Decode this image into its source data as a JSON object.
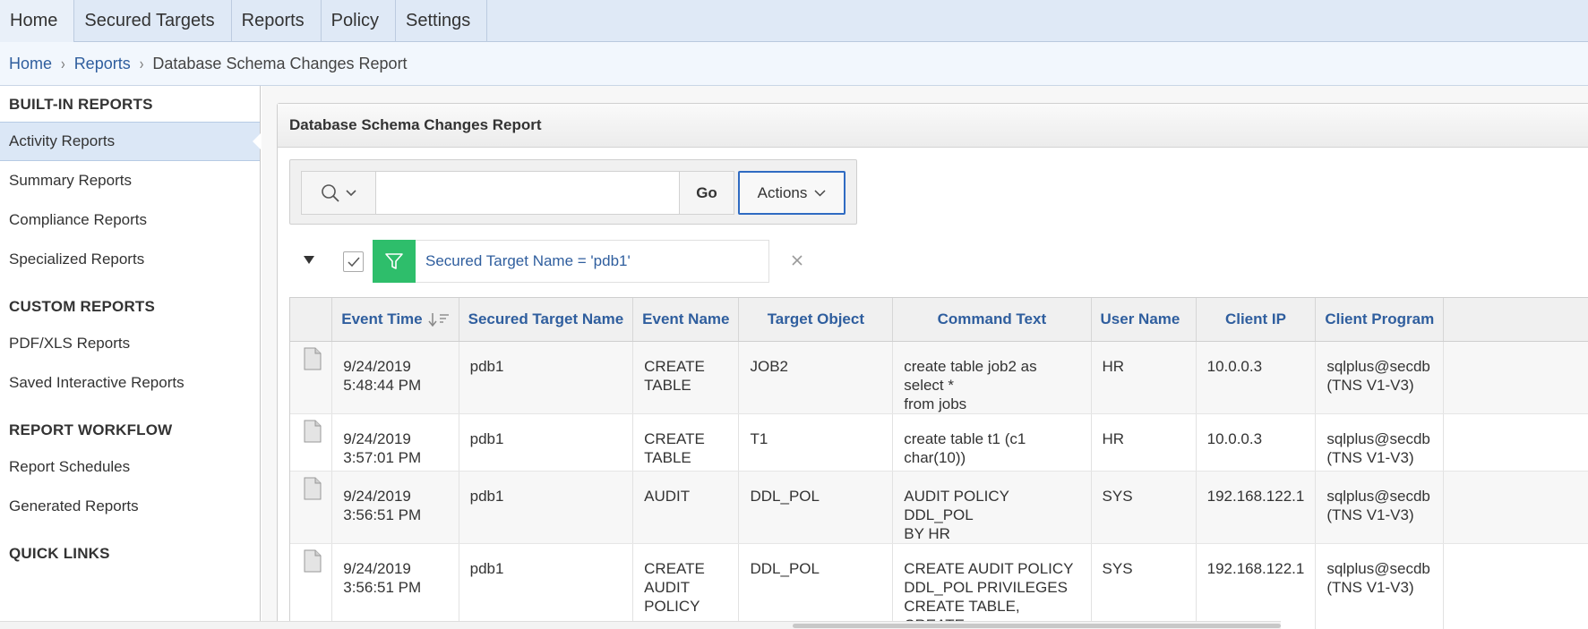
{
  "topnav": {
    "tabs": [
      "Home",
      "Secured Targets",
      "Reports",
      "Policy",
      "Settings"
    ]
  },
  "breadcrumb": {
    "home": "Home",
    "reports": "Reports",
    "current": "Database Schema Changes Report"
  },
  "sidebar": {
    "builtin_heading": "BUILT-IN REPORTS",
    "builtin_items": [
      "Activity Reports",
      "Summary Reports",
      "Compliance Reports",
      "Specialized Reports"
    ],
    "custom_heading": "CUSTOM REPORTS",
    "custom_items": [
      "PDF/XLS Reports",
      "Saved Interactive Reports"
    ],
    "workflow_heading": "REPORT WORKFLOW",
    "workflow_items": [
      "Report Schedules",
      "Generated Reports"
    ],
    "quicklinks_heading": "QUICK LINKS",
    "active_item": "Activity Reports"
  },
  "report": {
    "title": "Database Schema Changes Report",
    "search": {
      "value": "",
      "placeholder": ""
    },
    "go_label": "Go",
    "actions_label": "Actions",
    "filter_text": "Secured Target Name = 'pdb1'",
    "columns": [
      "Event Time",
      "Secured Target Name",
      "Event Name",
      "Target Object",
      "Command Text",
      "User Name",
      "Client IP",
      "Client Program"
    ],
    "rows": [
      {
        "event_time_1": "9/24/2019",
        "event_time_2": "5:48:44 PM",
        "target": "pdb1",
        "event_1": "CREATE",
        "event_2": "TABLE",
        "event_3": "",
        "object": "JOB2",
        "cmd_1": "create table job2 as select *",
        "cmd_2": "from jobs",
        "cmd_3": "",
        "user": "HR",
        "ip": "10.0.0.3",
        "prog_1": "sqlplus@secdb",
        "prog_2": "(TNS V1-V3)"
      },
      {
        "event_time_1": "9/24/2019",
        "event_time_2": "3:57:01 PM",
        "target": "pdb1",
        "event_1": "CREATE",
        "event_2": "TABLE",
        "event_3": "",
        "object": "T1",
        "cmd_1": "create table t1 (c1 char(10))",
        "cmd_2": "",
        "cmd_3": "",
        "user": "HR",
        "ip": "10.0.0.3",
        "prog_1": "sqlplus@secdb",
        "prog_2": "(TNS V1-V3)"
      },
      {
        "event_time_1": "9/24/2019",
        "event_time_2": "3:56:51 PM",
        "target": "pdb1",
        "event_1": "AUDIT",
        "event_2": "",
        "event_3": "",
        "object": "DDL_POL",
        "cmd_1": "AUDIT POLICY DDL_POL",
        "cmd_2": "BY HR",
        "cmd_3": "",
        "user": "SYS",
        "ip": "192.168.122.1",
        "prog_1": "sqlplus@secdb",
        "prog_2": "(TNS V1-V3)"
      },
      {
        "event_time_1": "9/24/2019",
        "event_time_2": "3:56:51 PM",
        "target": "pdb1",
        "event_1": "CREATE",
        "event_2": "AUDIT",
        "event_3": "POLICY",
        "object": "DDL_POL",
        "cmd_1": "CREATE AUDIT POLICY",
        "cmd_2": "DDL_POL PRIVILEGES",
        "cmd_3": "CREATE TABLE, CREATE",
        "user": "SYS",
        "ip": "192.168.122.1",
        "prog_1": "sqlplus@secdb",
        "prog_2": "(TNS V1-V3)"
      }
    ]
  },
  "colors": {
    "accent_link": "#2f5e9e",
    "filter_green": "#2ebe6b",
    "nav_bg": "#dfe9f6"
  }
}
